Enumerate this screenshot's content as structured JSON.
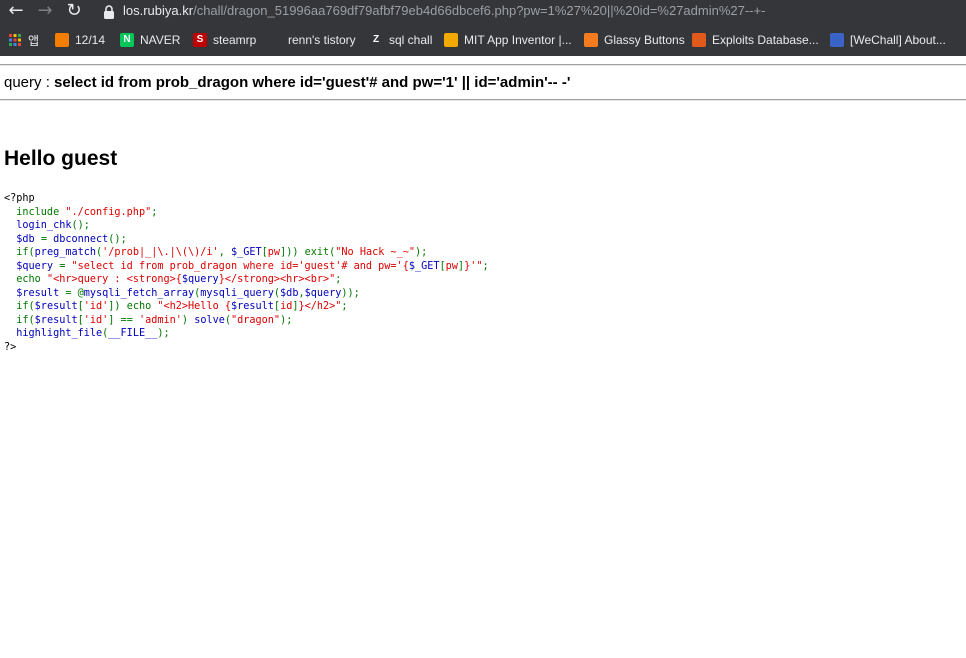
{
  "browser": {
    "back_glyph": "←",
    "forward_glyph": "→",
    "reload_glyph": "↻",
    "url_host": "los.rubiya.kr",
    "url_path": "/chall/dragon_51996aa769df79afbf79eb4d66dbcef6.php?pw=1%27%20||%20id=%27admin%27--+-",
    "bookmarks": [
      {
        "label": "앱",
        "icon": "apps-grid-icon",
        "color": "#ea4335"
      },
      {
        "label": "12/14",
        "icon": "blogger-icon",
        "color": "#f57d00"
      },
      {
        "label": "NAVER",
        "icon": "naver-icon",
        "color": "#03c75a",
        "glyph": "N"
      },
      {
        "label": "steamrp",
        "icon": "steamrp-icon",
        "color": "#c00000",
        "glyph": "S"
      },
      {
        "label": "renn's tistory",
        "icon": "tistory-icon",
        "color": "#ffffff"
      },
      {
        "label": "sql chall",
        "icon": "z-icon",
        "color": "#ffffff",
        "glyph": "Z"
      },
      {
        "label": "MIT App Inventor |...",
        "icon": "app-inventor-icon",
        "color": "#f2a900"
      },
      {
        "label": "Glassy Buttons",
        "icon": "glassy-buttons-icon",
        "color": "#f47c20"
      },
      {
        "label": "Exploits Database...",
        "icon": "exploit-db-icon",
        "color": "#e05a1c"
      },
      {
        "label": "[WeChall] About...",
        "icon": "wechall-icon",
        "color": "#3a63c7"
      }
    ]
  },
  "page": {
    "query_prefix": "query : ",
    "query": "select id from prob_dragon where id='guest'# and pw='1' || id='admin'-- -'",
    "hello": "Hello guest"
  },
  "source_code": [
    [
      {
        "c": "html",
        "t": "<?php"
      }
    ],
    [
      {
        "c": "kw",
        "t": "  include "
      },
      {
        "c": "st",
        "t": "\"./config.php\""
      },
      {
        "c": "kw",
        "t": ";"
      }
    ],
    [
      {
        "c": "df",
        "t": "  login_chk"
      },
      {
        "c": "kw",
        "t": "();"
      }
    ],
    [
      {
        "c": "df",
        "t": "  $db "
      },
      {
        "c": "kw",
        "t": "= "
      },
      {
        "c": "df",
        "t": "dbconnect"
      },
      {
        "c": "kw",
        "t": "();"
      }
    ],
    [
      {
        "c": "kw",
        "t": "  if("
      },
      {
        "c": "df",
        "t": "preg_match"
      },
      {
        "c": "kw",
        "t": "("
      },
      {
        "c": "st",
        "t": "'/prob|_|\\.|\\(\\)/i'"
      },
      {
        "c": "kw",
        "t": ", "
      },
      {
        "c": "df",
        "t": "$_GET"
      },
      {
        "c": "kw",
        "t": "["
      },
      {
        "c": "st",
        "t": "pw"
      },
      {
        "c": "kw",
        "t": "])) exit("
      },
      {
        "c": "st",
        "t": "\"No Hack ~_~\""
      },
      {
        "c": "kw",
        "t": ");"
      }
    ],
    [
      {
        "c": "df",
        "t": "  $query "
      },
      {
        "c": "kw",
        "t": "= "
      },
      {
        "c": "st",
        "t": "\"select id from prob_dragon where id='guest'# and pw='{"
      },
      {
        "c": "df",
        "t": "$_GET"
      },
      {
        "c": "kw",
        "t": "["
      },
      {
        "c": "st",
        "t": "pw"
      },
      {
        "c": "kw",
        "t": "]"
      },
      {
        "c": "st",
        "t": "}'\""
      },
      {
        "c": "kw",
        "t": ";"
      }
    ],
    [
      {
        "c": "kw",
        "t": "  echo "
      },
      {
        "c": "st",
        "t": "\"<hr>query : <strong>{"
      },
      {
        "c": "df",
        "t": "$query"
      },
      {
        "c": "st",
        "t": "}</strong><hr><br>\""
      },
      {
        "c": "kw",
        "t": ";"
      }
    ],
    [
      {
        "c": "df",
        "t": "  $result "
      },
      {
        "c": "kw",
        "t": "= @"
      },
      {
        "c": "df",
        "t": "mysqli_fetch_array"
      },
      {
        "c": "kw",
        "t": "("
      },
      {
        "c": "df",
        "t": "mysqli_query"
      },
      {
        "c": "kw",
        "t": "("
      },
      {
        "c": "df",
        "t": "$db"
      },
      {
        "c": "kw",
        "t": ","
      },
      {
        "c": "df",
        "t": "$query"
      },
      {
        "c": "kw",
        "t": "));"
      }
    ],
    [
      {
        "c": "kw",
        "t": "  if("
      },
      {
        "c": "df",
        "t": "$result"
      },
      {
        "c": "kw",
        "t": "["
      },
      {
        "c": "st",
        "t": "'id'"
      },
      {
        "c": "kw",
        "t": "]) echo "
      },
      {
        "c": "st",
        "t": "\"<h2>Hello {"
      },
      {
        "c": "df",
        "t": "$result"
      },
      {
        "c": "kw",
        "t": "["
      },
      {
        "c": "st",
        "t": "id"
      },
      {
        "c": "kw",
        "t": "]"
      },
      {
        "c": "st",
        "t": "}</h2>\""
      },
      {
        "c": "kw",
        "t": ";"
      }
    ],
    [
      {
        "c": "kw",
        "t": "  if("
      },
      {
        "c": "df",
        "t": "$result"
      },
      {
        "c": "kw",
        "t": "["
      },
      {
        "c": "st",
        "t": "'id'"
      },
      {
        "c": "kw",
        "t": "] == "
      },
      {
        "c": "st",
        "t": "'admin'"
      },
      {
        "c": "kw",
        "t": ") "
      },
      {
        "c": "df",
        "t": "solve"
      },
      {
        "c": "kw",
        "t": "("
      },
      {
        "c": "st",
        "t": "\"dragon\""
      },
      {
        "c": "kw",
        "t": ");"
      }
    ],
    [
      {
        "c": "df",
        "t": "  highlight_file"
      },
      {
        "c": "kw",
        "t": "("
      },
      {
        "c": "df",
        "t": "__FILE__"
      },
      {
        "c": "kw",
        "t": ");"
      }
    ],
    [
      {
        "c": "html",
        "t": "?>"
      }
    ]
  ]
}
